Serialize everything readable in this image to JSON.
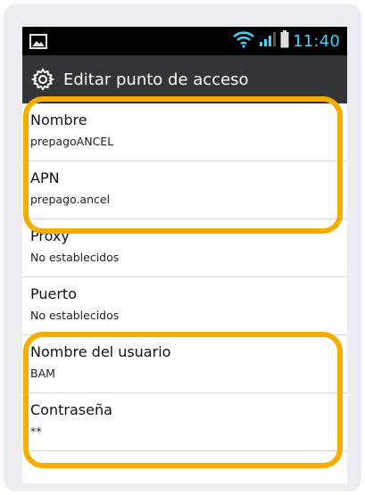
{
  "status_bar": {
    "time": "11:40",
    "icons": [
      "image-notification-icon",
      "wifi-icon",
      "signal-icon",
      "battery-icon"
    ]
  },
  "title_bar": {
    "icon": "gear-icon",
    "title": "Editar punto de acceso"
  },
  "settings_list": [
    {
      "title": "Nombre",
      "value": "prepagoANCEL"
    },
    {
      "title": "APN",
      "value": "prepago.ancel"
    },
    {
      "title": "Proxy",
      "value": "No establecidos"
    },
    {
      "title": "Puerto",
      "value": "No establecidos"
    },
    {
      "title": "Nombre del usuario",
      "value": "BAM"
    },
    {
      "title": "Contraseña",
      "value": "**"
    }
  ],
  "colors": {
    "highlight": "#f5ae00",
    "title_bar": "#333436",
    "status_time": "#3fd4ff"
  }
}
